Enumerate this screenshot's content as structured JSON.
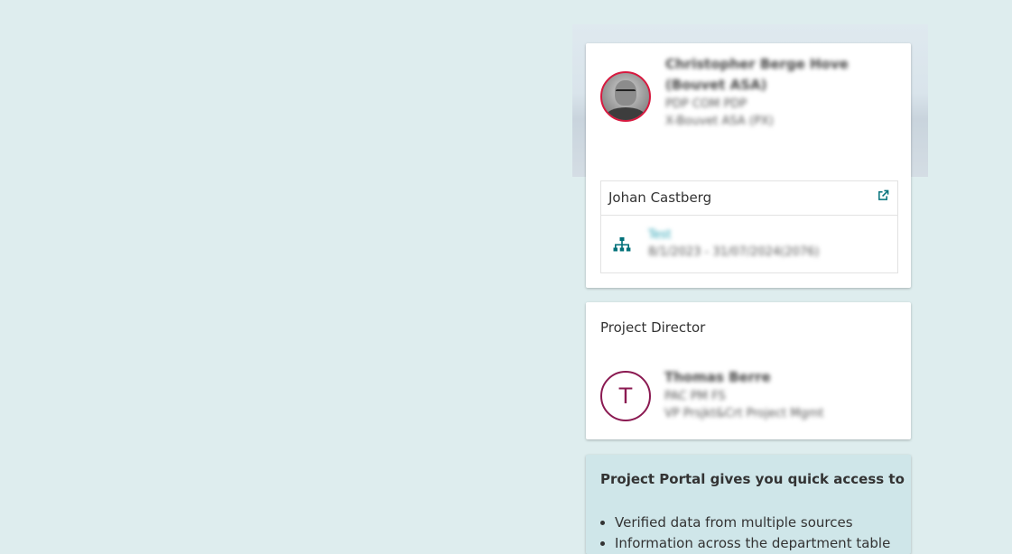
{
  "hero": {
    "image": "landscape-banner"
  },
  "colors": {
    "background": "#deedee",
    "photo_ring": "#d7193f",
    "initial_ring": "#8b1a52",
    "accent": "#007079",
    "info_bg": "#cfe6e9"
  },
  "profile": {
    "name": "Christopher Berge Hove (Bouvet ASA)",
    "department": "PDP COM PDP",
    "company": "X-Bouvet ASA (PX)",
    "avatar": "user-photo"
  },
  "project": {
    "name": "Johan Castberg",
    "external_link_icon": "external-link-icon",
    "org_icon": "org-chart-icon",
    "context_label": "Test",
    "context_dates": "8/1/2023 - 31/07/2024(2076)"
  },
  "director": {
    "section_title": "Project Director",
    "initial": "T",
    "name": "Thomas Berre",
    "department": "PAC PM FS",
    "role": "VP Prsjkt&Crt Project Mgmt"
  },
  "info": {
    "title": "Project Portal gives you quick access to",
    "items": [
      "Verified data from multiple sources",
      "Information across the department table"
    ]
  }
}
